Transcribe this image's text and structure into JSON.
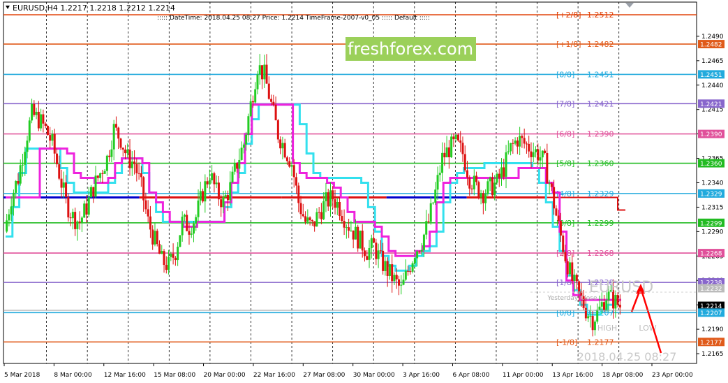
{
  "header": {
    "symbol_line": "EURUSD,H4  1.2217 1.2218 1.2212 1.2214",
    "info_line": "::::: DateTime: 2018.04.25 08:27    Price: 1.2214    TimeFrame-2007-v0_05    ::::: Default  :::::"
  },
  "watermark": {
    "brand": "freshforex.com",
    "symbol": "EURUSD",
    "datetime": "2018.04.25 08:27"
  },
  "overlay_labels": {
    "yesterday_close": "Yesterday Close",
    "high": "HIGH",
    "low": "LOW"
  },
  "murrey_levels": [
    {
      "tag": "[+2/8]",
      "value": "1.2512",
      "price": 1.2512,
      "color": "#e03c00"
    },
    {
      "tag": "[+1/8]",
      "value": "1.2482",
      "price": 1.2482,
      "color": "#e05a1a"
    },
    {
      "tag": "[8/8]",
      "value": "1.2451",
      "price": 1.2451,
      "color": "#22aadd"
    },
    {
      "tag": "[7/8]",
      "value": "1.2421",
      "price": 1.2421,
      "color": "#8866cc"
    },
    {
      "tag": "[6/8]",
      "value": "1.2390",
      "price": 1.239,
      "color": "#e0509a"
    },
    {
      "tag": "[5/8]",
      "value": "1.2360",
      "price": 1.236,
      "color": "#22bb22"
    },
    {
      "tag": "[4/8]",
      "value": "1.2329",
      "price": 1.2329,
      "color": "#22aadd"
    },
    {
      "tag": "[3/8]",
      "value": "1.2299",
      "price": 1.2299,
      "color": "#22bb22"
    },
    {
      "tag": "[2/8]",
      "value": "1.2268",
      "price": 1.2268,
      "color": "#e0509a"
    },
    {
      "tag": "[1/8]",
      "value": "1.2238",
      "price": 1.2238,
      "color": "#8866cc"
    },
    {
      "tag": "[0/8]",
      "value": "1.2207",
      "price": 1.2207,
      "color": "#22aadd"
    },
    {
      "tag": "[-1/8]",
      "value": "1.2177",
      "price": 1.2177,
      "color": "#e05a1a"
    }
  ],
  "price_axis": {
    "ticks": [
      "1.2490",
      "1.2465",
      "1.2440",
      "1.2415",
      "1.2390",
      "1.2365",
      "1.2340",
      "1.2315",
      "1.2290",
      "1.2265",
      "1.2240",
      "1.2215",
      "1.2190",
      "1.2165"
    ],
    "boxes": [
      {
        "label": "1.2482",
        "price": 1.2482,
        "bg": "#e05a1a",
        "fg": "#ffffff"
      },
      {
        "label": "1.2451",
        "price": 1.2451,
        "bg": "#22aadd",
        "fg": "#ffffff"
      },
      {
        "label": "1.2421",
        "price": 1.2421,
        "bg": "#8866cc",
        "fg": "#ffffff"
      },
      {
        "label": "1.2390",
        "price": 1.239,
        "bg": "#e0509a",
        "fg": "#ffffff"
      },
      {
        "label": "1.2360",
        "price": 1.236,
        "bg": "#22bb22",
        "fg": "#ffffff"
      },
      {
        "label": "1.2329",
        "price": 1.2329,
        "bg": "#22aadd",
        "fg": "#ffffff"
      },
      {
        "label": "1.2299",
        "price": 1.2299,
        "bg": "#22bb22",
        "fg": "#ffffff"
      },
      {
        "label": "1.2268",
        "price": 1.2268,
        "bg": "#e0509a",
        "fg": "#ffffff"
      },
      {
        "label": "1.2238",
        "price": 1.2238,
        "bg": "#8866cc",
        "fg": "#ffffff"
      },
      {
        "label": "1.2232",
        "price": 1.2232,
        "bg": "#bbbbbb",
        "fg": "#ffffff"
      },
      {
        "label": "1.2214",
        "price": 1.2214,
        "bg": "#000000",
        "fg": "#ffffff"
      },
      {
        "label": "1.2207",
        "price": 1.2207,
        "bg": "#22aadd",
        "fg": "#ffffff"
      },
      {
        "label": "1.2177",
        "price": 1.2177,
        "bg": "#e05a1a",
        "fg": "#ffffff"
      }
    ]
  },
  "time_axis": {
    "labels": [
      "5 Mar 2018",
      "8 Mar 00:00",
      "12 Mar 16:00",
      "15 Mar 08:00",
      "20 Mar 00:00",
      "22 Mar 16:00",
      "27 Mar 08:00",
      "30 Mar 00:00",
      "3 Apr 16:00",
      "6 Apr 08:00",
      "11 Apr 00:00",
      "13 Apr 16:00",
      "18 Apr 08:00",
      "23 Apr 00:00"
    ]
  },
  "colors": {
    "bull": "#22cc22",
    "bear": "#dd1111",
    "cyan_line": "#33e0ee",
    "magenta_line": "#ee22dd",
    "pivot_blue": "#0000cc",
    "pivot_red": "#dd1111",
    "grid": "#000000"
  },
  "chart_data": {
    "type": "candlestick",
    "title": "",
    "symbol": "EURUSD",
    "timeframe": "H4",
    "ylim": [
      1.2155,
      1.2525
    ],
    "last_price": 1.2214,
    "ohlc_last": {
      "open": 1.2217,
      "high": 1.2218,
      "low": 1.2212,
      "close": 1.2214
    },
    "price_path": [
      1.229,
      1.2325,
      1.2345,
      1.238,
      1.241,
      1.2405,
      1.2395,
      1.238,
      1.235,
      1.232,
      1.2305,
      1.23,
      1.2315,
      1.2335,
      1.235,
      1.2365,
      1.2395,
      1.2385,
      1.2365,
      1.236,
      1.2335,
      1.23,
      1.228,
      1.226,
      1.2255,
      1.227,
      1.23,
      1.2295,
      1.2305,
      1.233,
      1.235,
      1.233,
      1.232,
      1.2335,
      1.236,
      1.238,
      1.242,
      1.246,
      1.245,
      1.242,
      1.239,
      1.2375,
      1.236,
      1.232,
      1.23,
      1.2295,
      1.231,
      1.232,
      1.2325,
      1.2315,
      1.23,
      1.229,
      1.228,
      1.227,
      1.2275,
      1.226,
      1.225,
      1.224,
      1.223,
      1.225,
      1.227,
      1.228,
      1.23,
      1.233,
      1.2365,
      1.2375,
      1.238,
      1.237,
      1.2345,
      1.2335,
      1.233,
      1.2335,
      1.234,
      1.2355,
      1.2375,
      1.2385,
      1.238,
      1.2375,
      1.237,
      1.236,
      1.233,
      1.2295,
      1.2265,
      1.224,
      1.2225,
      1.221,
      1.22,
      1.221,
      1.2225,
      1.222,
      1.2214
    ],
    "cyan_ma": [
      1.2285,
      1.2315,
      1.235,
      1.2375,
      1.2375,
      1.2375,
      1.2375,
      1.2375,
      1.2355,
      1.234,
      1.233,
      1.233,
      1.233,
      1.233,
      1.233,
      1.234,
      1.235,
      1.2365,
      1.2365,
      1.2365,
      1.235,
      1.233,
      1.231,
      1.23,
      1.23,
      1.23,
      1.23,
      1.23,
      1.23,
      1.23,
      1.23,
      1.23,
      1.2315,
      1.233,
      1.235,
      1.238,
      1.2405,
      1.242,
      1.242,
      1.242,
      1.242,
      1.242,
      1.242,
      1.24,
      1.237,
      1.235,
      1.2345,
      1.2345,
      1.2345,
      1.2345,
      1.2345,
      1.2345,
      1.234,
      1.2315,
      1.229,
      1.2265,
      1.2255,
      1.225,
      1.225,
      1.2255,
      1.2265,
      1.227,
      1.2275,
      1.229,
      1.232,
      1.234,
      1.235,
      1.2355,
      1.2355,
      1.2355,
      1.236,
      1.236,
      1.236,
      1.236,
      1.236,
      1.236,
      1.236,
      1.2355,
      1.234,
      1.232,
      1.2295,
      1.227,
      1.2245,
      1.223,
      1.2215,
      1.2205,
      1.2205,
      1.221,
      1.2215,
      1.222,
      1.222
    ],
    "magenta_ma": [
      1.2325,
      1.2325,
      1.2325,
      1.2325,
      1.2325,
      1.2375,
      1.2375,
      1.2375,
      1.2375,
      1.237,
      1.235,
      1.2345,
      1.2345,
      1.234,
      1.234,
      1.2345,
      1.236,
      1.2365,
      1.2365,
      1.2365,
      1.236,
      1.233,
      1.232,
      1.231,
      1.23,
      1.23,
      1.2295,
      1.2295,
      1.23,
      1.23,
      1.23,
      1.23,
      1.232,
      1.234,
      1.236,
      1.239,
      1.242,
      1.242,
      1.242,
      1.242,
      1.242,
      1.242,
      1.236,
      1.235,
      1.2345,
      1.2345,
      1.2345,
      1.234,
      1.2335,
      1.2325,
      1.231,
      1.23,
      1.23,
      1.23,
      1.2295,
      1.2285,
      1.227,
      1.2265,
      1.2265,
      1.2265,
      1.227,
      1.2275,
      1.229,
      1.232,
      1.234,
      1.2345,
      1.2345,
      1.2345,
      1.2345,
      1.2345,
      1.2345,
      1.2345,
      1.2345,
      1.2345,
      1.2345,
      1.2355,
      1.2355,
      1.2355,
      1.2355,
      1.234,
      1.233,
      1.229,
      1.224,
      1.2225,
      1.222,
      1.222,
      1.222,
      1.222,
      1.222,
      1.222,
      1.222
    ],
    "pivot": {
      "value": 1.2325,
      "segments": [
        {
          "from": 0,
          "to": 0.22,
          "color": "blue"
        },
        {
          "from": 0.22,
          "to": 0.45,
          "color": "red"
        },
        {
          "from": 0.45,
          "to": 0.62,
          "color": "red"
        },
        {
          "from": 0.62,
          "to": 0.75,
          "color": "blue"
        },
        {
          "from": 0.75,
          "to": 0.88,
          "color": "red"
        }
      ]
    }
  }
}
